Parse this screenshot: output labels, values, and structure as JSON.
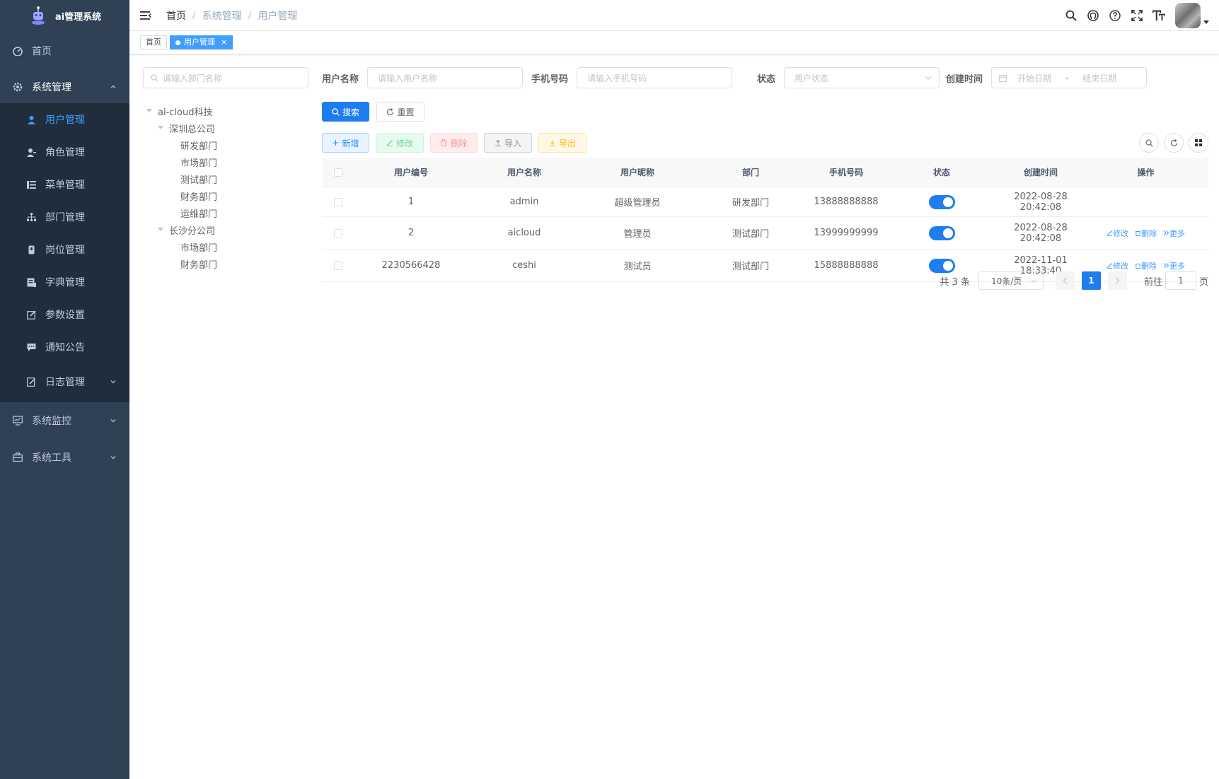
{
  "app": {
    "title": "ai管理系统"
  },
  "sidebar": {
    "items": [
      {
        "label": "首页",
        "icon": "dashboard-icon"
      },
      {
        "label": "系统管理",
        "icon": "gear-icon"
      },
      {
        "label": "系统监控",
        "icon": "monitor-icon"
      },
      {
        "label": "系统工具",
        "icon": "toolbox-icon"
      }
    ],
    "sub_items": [
      {
        "label": "用户管理",
        "icon": "user-icon"
      },
      {
        "label": "角色管理",
        "icon": "role-icon"
      },
      {
        "label": "菜单管理",
        "icon": "tree-table-icon"
      },
      {
        "label": "部门管理",
        "icon": "org-icon"
      },
      {
        "label": "岗位管理",
        "icon": "post-icon"
      },
      {
        "label": "字典管理",
        "icon": "dict-icon"
      },
      {
        "label": "参数设置",
        "icon": "edit-icon"
      },
      {
        "label": "通知公告",
        "icon": "message-icon"
      },
      {
        "label": "日志管理",
        "icon": "log-icon"
      }
    ]
  },
  "navbar": {
    "breadcrumb": [
      "首页",
      "系统管理",
      "用户管理"
    ],
    "separator": "/"
  },
  "tags": {
    "home": "首页",
    "active": "用户管理",
    "close": "×"
  },
  "dept": {
    "placeholder": "请输入部门名称",
    "tree": [
      {
        "label": "ai-cloud科技",
        "level": 0,
        "caret": true
      },
      {
        "label": "深圳总公司",
        "level": 1,
        "caret": true
      },
      {
        "label": "研发部门",
        "level": 2,
        "caret": false
      },
      {
        "label": "市场部门",
        "level": 2,
        "caret": false
      },
      {
        "label": "测试部门",
        "level": 2,
        "caret": false
      },
      {
        "label": "财务部门",
        "level": 2,
        "caret": false
      },
      {
        "label": "运维部门",
        "level": 2,
        "caret": false
      },
      {
        "label": "长沙分公司",
        "level": 1,
        "caret": true
      },
      {
        "label": "市场部门",
        "level": 2,
        "caret": false
      },
      {
        "label": "财务部门",
        "level": 2,
        "caret": false
      }
    ]
  },
  "search_form": {
    "username_label": "用户名称",
    "username_placeholder": "请输入用户名称",
    "phone_label": "手机号码",
    "phone_placeholder": "请输入手机号码",
    "status_label": "状态",
    "status_placeholder": "用户状态",
    "time_label": "创建时间",
    "start_placeholder": "开始日期",
    "range_sep": "-",
    "end_placeholder": "结束日期",
    "search_btn": "搜索",
    "reset_btn": "重置"
  },
  "toolbar": {
    "add": "新增",
    "edit": "修改",
    "delete": "删除",
    "import": "导入",
    "export": "导出"
  },
  "table": {
    "headers": [
      "用户编号",
      "用户名称",
      "用户昵称",
      "部门",
      "手机号码",
      "状态",
      "创建时间",
      "操作"
    ],
    "rows": [
      {
        "id": "1",
        "username": "admin",
        "nickname": "超级管理员",
        "dept": "研发部门",
        "phone": "13888888888",
        "status": "enabled",
        "created": "2022-08-28 20:42:08",
        "actions": false
      },
      {
        "id": "2",
        "username": "aicloud",
        "nickname": "管理员",
        "dept": "测试部门",
        "phone": "13999999999",
        "status": "enabled",
        "created": "2022-08-28 20:42:08",
        "actions": true
      },
      {
        "id": "2230566428",
        "username": "ceshi",
        "nickname": "测试员",
        "dept": "测试部门",
        "phone": "15888888888",
        "status": "enabled",
        "created": "2022-11-01 18:33:40",
        "actions": true
      }
    ],
    "op_edit": "修改",
    "op_delete": "删除",
    "op_more": "更多"
  },
  "pagination": {
    "total": "共 3 条",
    "page_size": "10条/页",
    "current": "1",
    "goto_label": "前往",
    "goto_value": "1",
    "page_suffix": "页"
  },
  "colors": {
    "sidebar_bg": "#304156",
    "submenu_bg": "#1f2d3d",
    "primary": "#1e7ef0",
    "active_menu": "#409eff"
  }
}
